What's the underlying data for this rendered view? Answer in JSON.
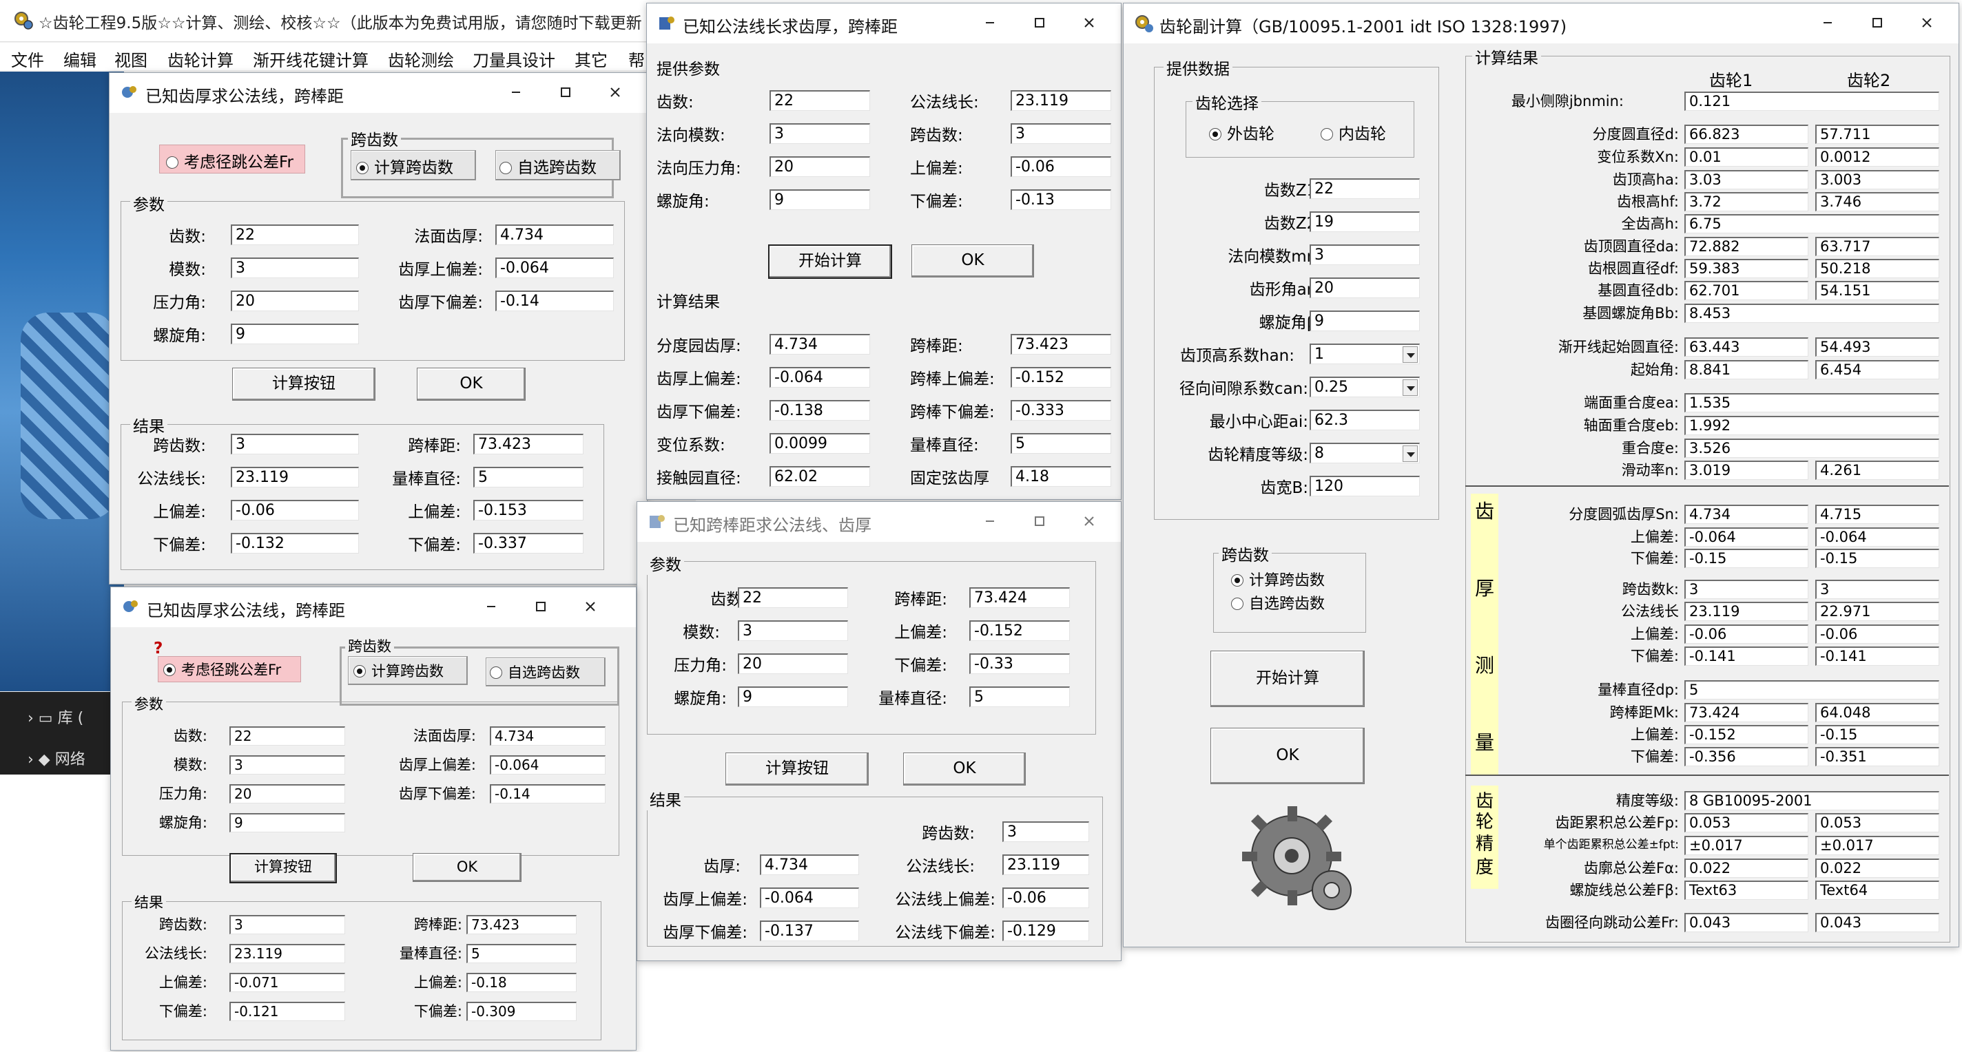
{
  "main_app": {
    "title": "☆齿轮工程9.5版☆☆计算、测绘、校核☆☆（此版本为免费试用版，请您随时下载更新",
    "menu": [
      "文件",
      "编辑",
      "视图",
      "齿轮计算",
      "渐开线花键计算",
      "齿轮测绘",
      "刀量具设计",
      "其它",
      "帮"
    ],
    "explorer": {
      "library": "库 (",
      "network": "网络"
    }
  },
  "win_a": {
    "title": "已知齿厚求公法线，跨棒距",
    "consider_runout": "考虑径跳公差Fr",
    "span_group": "跨齿数",
    "calc_span": "计算跨齿数",
    "self_span": "自选跨齿数",
    "params_group": "参数",
    "params": {
      "teeth_label": "齿数:",
      "teeth": "22",
      "module_label": "模数:",
      "module": "3",
      "pressure_label": "压力角:",
      "pressure": "20",
      "helix_label": "螺旋角:",
      "helix": "9",
      "thick_label": "法面齿厚:",
      "thick": "4.734",
      "up_dev_label": "齿厚上偏差:",
      "up_dev": "-0.064",
      "low_dev_label": "齿厚下偏差:",
      "low_dev": "-0.14"
    },
    "calc_button": "计算按钮",
    "ok_button": "OK",
    "results_group": "结果",
    "results": {
      "span_label": "跨齿数:",
      "span": "3",
      "wk_label": "公法线长:",
      "wk": "23.119",
      "up_label": "上偏差:",
      "up": "-0.06",
      "low_label": "下偏差:",
      "low": "-0.132",
      "mk_label": "跨棒距:",
      "mk": "73.423",
      "dp_label": "量棒直径:",
      "dp": "5",
      "mk_up_label": "上偏差:",
      "mk_up": "-0.153",
      "mk_low_label": "下偏差:",
      "mk_low": "-0.337"
    }
  },
  "win_b": {
    "title": "已知齿厚求公法线，跨棒距",
    "question": "?",
    "consider_runout": "考虑径跳公差Fr",
    "span_group": "跨齿数",
    "calc_span": "计算跨齿数",
    "self_span": "自选跨齿数",
    "params_group": "参数",
    "params": {
      "teeth_label": "齿数:",
      "teeth": "22",
      "module_label": "模数:",
      "module": "3",
      "pressure_label": "压力角:",
      "pressure": "20",
      "helix_label": "螺旋角:",
      "helix": "9",
      "thick_label": "法面齿厚:",
      "thick": "4.734",
      "up_dev_label": "齿厚上偏差:",
      "up_dev": "-0.064",
      "low_dev_label": "齿厚下偏差:",
      "low_dev": "-0.14"
    },
    "calc_button": "计算按钮",
    "ok_button": "OK",
    "results_group": "结果",
    "results": {
      "span_label": "跨齿数:",
      "span": "3",
      "wk_label": "公法线长:",
      "wk": "23.119",
      "up_label": "上偏差:",
      "up": "-0.071",
      "low_label": "下偏差:",
      "low": "-0.121",
      "mk_label": "跨棒距:",
      "mk": "73.423",
      "dp_label": "量棒直径:",
      "dp": "5",
      "mk_up_label": "上偏差:",
      "mk_up": "-0.18",
      "mk_low_label": "下偏差:",
      "mk_low": "-0.309"
    }
  },
  "win_c": {
    "title": "已知公法线长求齿厚，跨棒距",
    "provide_group": "提供参数",
    "teeth_label": "齿数:",
    "teeth": "22",
    "module_label": "法向模数:",
    "module": "3",
    "pressure_label": "法向压力角:",
    "pressure": "20",
    "helix_label": "螺旋角:",
    "helix": "9",
    "wk_label": "公法线长:",
    "wk": "23.119",
    "span_label": "跨齿数:",
    "span": "3",
    "up_label": "上偏差:",
    "up": "-0.06",
    "low_label": "下偏差:",
    "low": "-0.13",
    "start_button": "开始计算",
    "ok_button": "OK",
    "results_group": "计算结果",
    "r_thick_label": "分度园齿厚:",
    "r_thick": "4.734",
    "r_up_label": "齿厚上偏差:",
    "r_up": "-0.064",
    "r_low_label": "齿厚下偏差:",
    "r_low": "-0.138",
    "r_shift_label": "变位系数:",
    "r_shift": "0.0099",
    "r_contact_label": "接触园直径:",
    "r_contact": "62.02",
    "r_mk_label": "跨棒距:",
    "r_mk": "73.423",
    "r_mk_up_label": "跨棒上偏差:",
    "r_mk_up": "-0.152",
    "r_mk_low_label": "跨棒下偏差:",
    "r_mk_low": "-0.333",
    "r_dp_label": "量棒直径:",
    "r_dp": "5",
    "r_chord_label": "固定弦齿厚",
    "r_chord": "4.18"
  },
  "win_d": {
    "title": "已知跨棒距求公法线、齿厚",
    "params_group": "参数",
    "teeth_label": "齿数:",
    "teeth": "22",
    "module_label": "模数:",
    "module": "3",
    "pressure_label": "压力角:",
    "pressure": "20",
    "helix_label": "螺旋角:",
    "helix": "9",
    "mk_label": "跨棒距:",
    "mk": "73.424",
    "up_label": "上偏差:",
    "up": "-0.152",
    "low_label": "下偏差:",
    "low": "-0.33",
    "dp_label": "量棒直径:",
    "dp": "5",
    "calc_button": "计算按钮",
    "ok_button": "OK",
    "results_group": "结果",
    "r_span_label": "跨齿数:",
    "r_span": "3",
    "r_thick_label": "齿厚:",
    "r_thick": "4.734",
    "r_up_label": "齿厚上偏差:",
    "r_up": "-0.064",
    "r_low_label": "齿厚下偏差:",
    "r_low": "-0.137",
    "r_wk_label": "公法线长:",
    "r_wk": "23.119",
    "r_wk_up_label": "公法线上偏差:",
    "r_wk_up": "-0.06",
    "r_wk_low_label": "公法线下偏差:",
    "r_wk_low": "-0.129"
  },
  "win_e": {
    "title": "齿轮副计算（GB/10095.1-2001 idt ISO 1328:1997)",
    "provide_group": "提供数据",
    "gear_select_group": "齿轮选择",
    "external": "外齿轮",
    "internal": "内齿轮",
    "z1_label": "齿数Z1:",
    "z1": "22",
    "z2_label": "齿数Z2:",
    "z2": "19",
    "mn_label": "法向模数mn:",
    "mn": "3",
    "an_label": "齿形角an:",
    "an": "20",
    "beta_label": "螺旋角β:",
    "beta": "9",
    "han_label": "齿顶高系数han:",
    "han": "1",
    "can_label": "径向间隙系数can:",
    "can": "0.25",
    "ai_label": "最小中心距ai:",
    "ai": "62.3",
    "grade_label": "齿轮精度等级:",
    "grade": "8",
    "width_label": "齿宽B:",
    "width": "120",
    "span_group": "跨齿数",
    "calc_span": "计算跨齿数",
    "self_span": "自选跨齿数",
    "start_button": "开始计算",
    "ok_button": "OK",
    "results_group": "计算结果",
    "gear1": "齿轮1",
    "gear2": "齿轮2",
    "jbn_label": "最小侧隙jbnmin:",
    "jbn": "0.121",
    "rows1": [
      {
        "label": "分度圆直径d:",
        "g1": "66.823",
        "g2": "57.711"
      },
      {
        "label": "变位系数Xn:",
        "g1": "0.01",
        "g2": "0.0012"
      },
      {
        "label": "齿顶高ha:",
        "g1": "3.03",
        "g2": "3.003"
      },
      {
        "label": "齿根高hf:",
        "g1": "3.72",
        "g2": "3.746"
      },
      {
        "label": "全齿高h:",
        "g1": "6.75"
      },
      {
        "label": "齿顶圆直径da:",
        "g1": "72.882",
        "g2": "63.717"
      },
      {
        "label": "齿根圆直径df:",
        "g1": "59.383",
        "g2": "50.218"
      },
      {
        "label": "基圆直径db:",
        "g1": "62.701",
        "g2": "54.151"
      },
      {
        "label": "基圆螺旋角Bb:",
        "g1": "8.453"
      }
    ],
    "rows2": [
      {
        "label": "渐开线起始圆直径:",
        "g1": "63.443",
        "g2": "54.493"
      },
      {
        "label": "起始角:",
        "g1": "8.841",
        "g2": "6.454"
      }
    ],
    "rows3": [
      {
        "label": "端面重合度ea:",
        "g1": "1.535"
      },
      {
        "label": "轴面重合度eb:",
        "g1": "1.992"
      },
      {
        "label": "重合度e:",
        "g1": "3.526"
      },
      {
        "label": "滑动率n:",
        "g1": "3.019",
        "g2": "4.261"
      }
    ],
    "thickness_vertical": [
      "齿",
      "厚",
      "测",
      "量"
    ],
    "rows4": [
      {
        "label": "分度圆弧齿厚Sn:",
        "g1": "4.734",
        "g2": "4.715"
      },
      {
        "label": "上偏差:",
        "g1": "-0.064",
        "g2": "-0.064"
      },
      {
        "label": "下偏差:",
        "g1": "-0.15",
        "g2": "-0.15"
      },
      {
        "label": "跨齿数k:",
        "g1": "3",
        "g2": "3"
      },
      {
        "label": "公法线长",
        "g1": "23.119",
        "g2": "22.971"
      },
      {
        "label": "上偏差:",
        "g1": "-0.06",
        "g2": "-0.06"
      },
      {
        "label": "下偏差:",
        "g1": "-0.141",
        "g2": "-0.141"
      }
    ],
    "rows5": [
      {
        "label": "量棒直径dp:",
        "g1": "5"
      },
      {
        "label": "跨棒距Mk:",
        "g1": "73.424",
        "g2": "64.048"
      },
      {
        "label": "上偏差:",
        "g1": "-0.152",
        "g2": "-0.15"
      },
      {
        "label": "下偏差:",
        "g1": "-0.356",
        "g2": "-0.351"
      }
    ],
    "accuracy_vertical": [
      "齿",
      "轮",
      "精",
      "度"
    ],
    "rows6": [
      {
        "label": "精度等级:",
        "g1": "8  GB10095-2001"
      },
      {
        "label": "齿距累积总公差Fp:",
        "g1": "0.053",
        "g2": "0.053"
      },
      {
        "label": "单个齿距累积总公差±fpt:",
        "g1": "±0.017",
        "g2": "±0.017"
      },
      {
        "label": "齿廓总公差Fα:",
        "g1": "0.022",
        "g2": "0.022"
      },
      {
        "label": "螺旋线总公差Fβ:",
        "g1": "Text63",
        "g2": "Text64"
      },
      {
        "label": "齿圈径向跳动公差Fr:",
        "g1": "0.043",
        "g2": "0.043"
      }
    ]
  }
}
